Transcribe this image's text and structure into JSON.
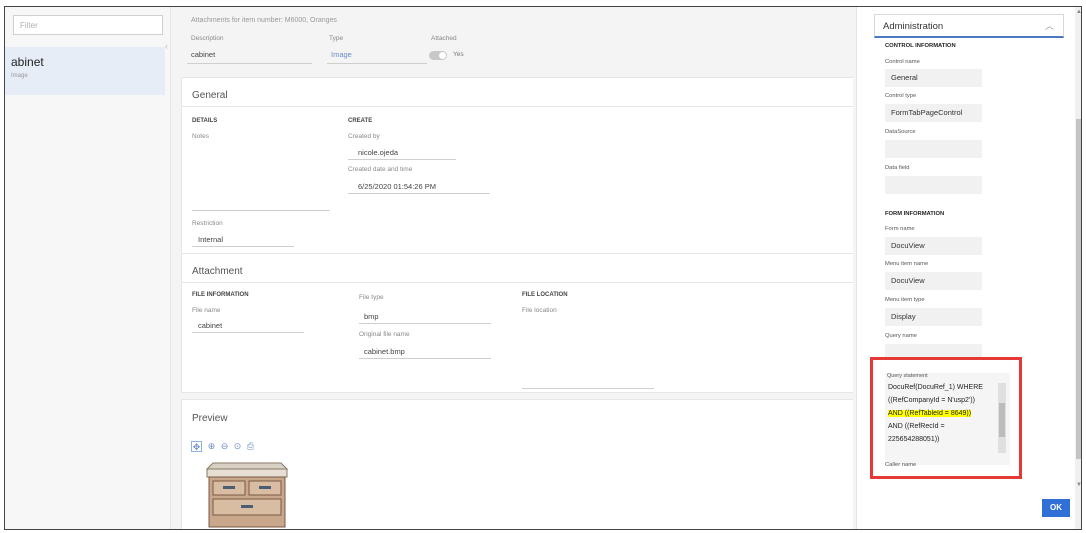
{
  "left": {
    "filter_placeholder": "Filter",
    "item": {
      "name": "abinet",
      "sub": "Image"
    }
  },
  "main": {
    "header_title": "Attachments for item number: M6000, Oranges",
    "description_label": "Description",
    "description_value": "cabinet",
    "type_label": "Type",
    "type_value": "Image",
    "attached_label": "Attached",
    "attached_value": "Yes",
    "general": {
      "title": "General",
      "details_head": "DETAILS",
      "notes_label": "Notes",
      "create_head": "CREATE",
      "created_by_label": "Created by",
      "created_by_value": "nicole.ojeda",
      "created_dt_label": "Created date and time",
      "created_dt_value": "6/25/2020 01:54:26 PM",
      "restriction_label": "Restriction",
      "restriction_value": "Internal"
    },
    "attachment": {
      "title": "Attachment",
      "file_info_head": "FILE INFORMATION",
      "file_name_label": "File name",
      "file_name_value": "cabinet",
      "file_type_label": "File type",
      "file_type_value": "bmp",
      "orig_name_label": "Original file name",
      "orig_name_value": "cabinet.bmp",
      "file_loc_head": "FILE LOCATION",
      "file_loc_label": "File location"
    },
    "preview": {
      "title": "Preview",
      "tools": [
        "move-icon",
        "zoom-in-icon",
        "zoom-out-icon",
        "zoom-fit-icon",
        "print-icon"
      ]
    }
  },
  "admin": {
    "header": "Administration",
    "control_head": "CONTROL INFORMATION",
    "control_name_label": "Control name",
    "control_name_value": "General",
    "control_type_label": "Control type",
    "control_type_value": "FormTabPageControl",
    "datasource_label": "DataSource",
    "datafield_label": "Data field",
    "form_head": "FORM INFORMATION",
    "form_name_label": "Form name",
    "form_name_value": "DocuView",
    "menu_item_name_label": "Menu item name",
    "menu_item_name_value": "DocuView",
    "menu_item_type_label": "Menu item type",
    "menu_item_type_value": "Display",
    "query_name_label": "Query name",
    "query_stmt_label": "Query statement",
    "query_lines": [
      "DocuRef(DocuRef_1) WHERE",
      "((RefCompanyId = N'usp2'))",
      "AND ((RefTableId = 8649))",
      "AND ((RefRecId =",
      "225654288051))"
    ],
    "caller_name_label": "Caller name",
    "highlight_color": "#ffff00",
    "callout_color": "#e53935"
  },
  "ok_label": "OK"
}
